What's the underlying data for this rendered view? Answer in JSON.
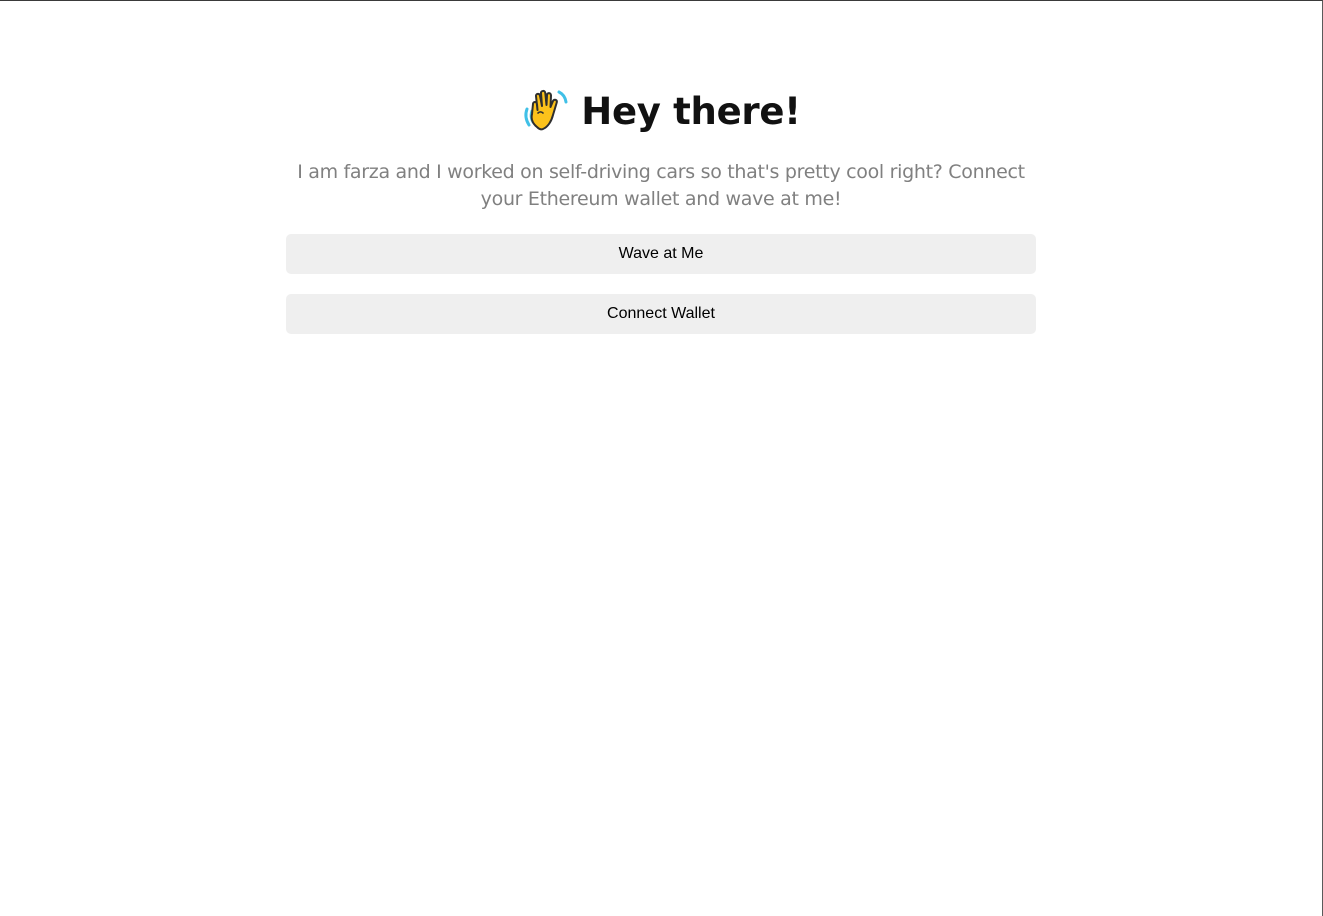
{
  "header": {
    "icon": "waving-hand-icon",
    "title": "Hey there!"
  },
  "bio": {
    "text": "I am farza and I worked on self-driving cars so that's pretty cool right? Connect your Ethereum wallet and wave at me!"
  },
  "buttons": {
    "wave_label": "Wave at Me",
    "connect_label": "Connect Wallet"
  },
  "colors": {
    "title": "#111111",
    "bio": "#808080",
    "button_bg": "#efefef",
    "hand_fill": "#fcc21b",
    "hand_outline": "#2f2f2f",
    "motion_lines": "#40c0e7"
  }
}
